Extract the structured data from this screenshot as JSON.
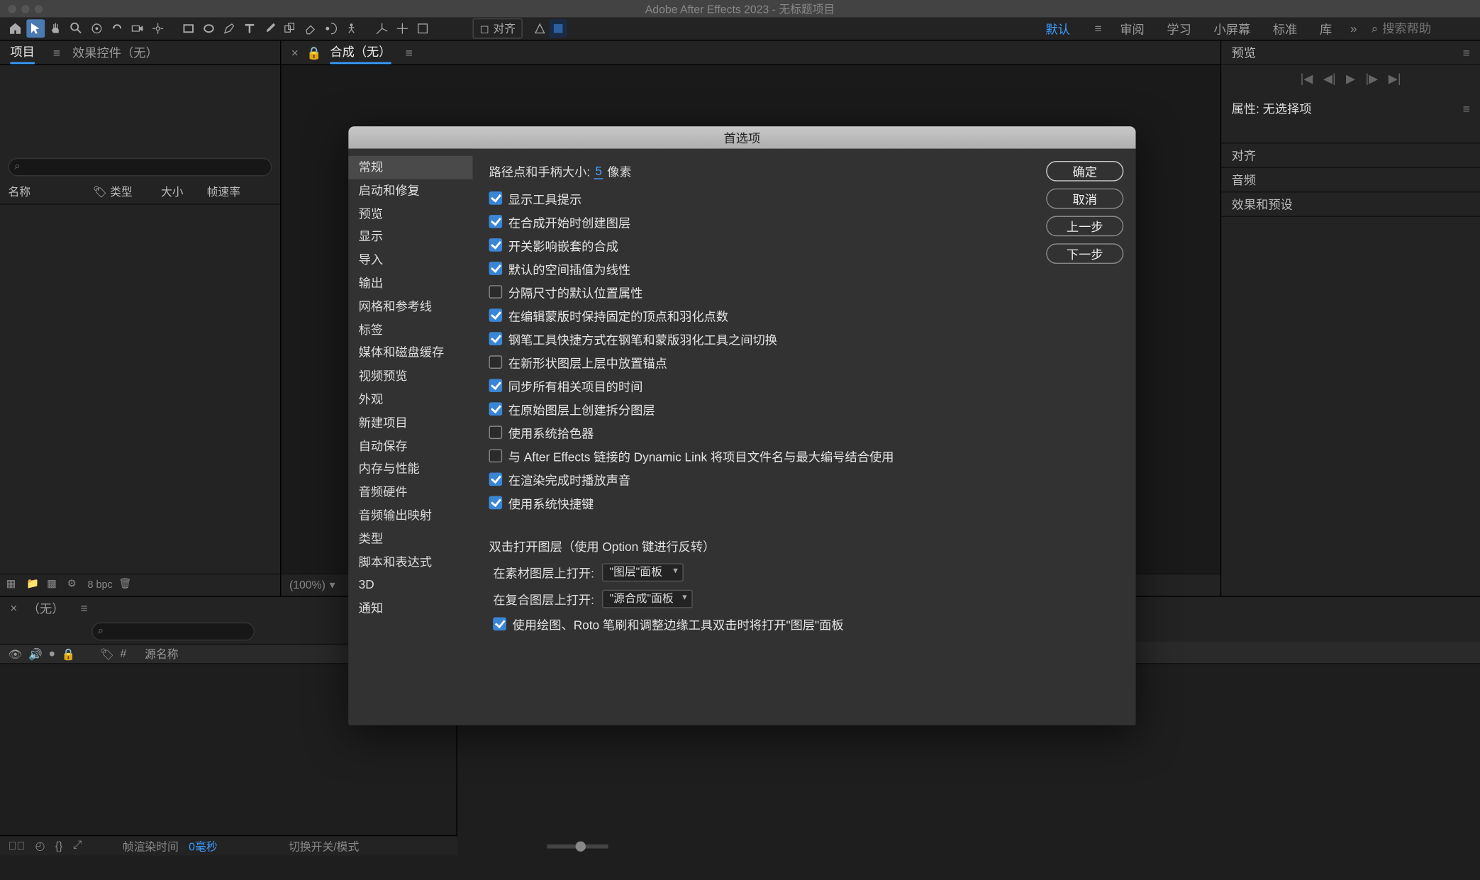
{
  "title_bar": {
    "title": "Adobe After Effects 2023 - 无标题项目"
  },
  "toolbar": {
    "align_label": "对齐",
    "workspaces": [
      "默认",
      "审阅",
      "学习",
      "小屏幕",
      "标准",
      "库"
    ],
    "active_workspace": "默认",
    "search_placeholder": "搜索帮助"
  },
  "left_panel": {
    "tabs": {
      "project": "项目",
      "effect_controls": "效果控件（无）"
    },
    "columns": {
      "name": "名称",
      "tag": "",
      "type": "类型",
      "size": "大小",
      "fps": "帧速率"
    },
    "footer_bpc": "8 bpc"
  },
  "comp_panel": {
    "tab_label": "合成（无）",
    "zoom": "(100%)"
  },
  "right_panel": {
    "preview": "预览",
    "attrs_title": "属性: 无选择项",
    "rows": [
      "对齐",
      "音频",
      "效果和预设"
    ]
  },
  "timeline": {
    "tab": "（无）",
    "col_source": "源名称",
    "status_frame_render": "帧渲染时间",
    "status_time_val": "0毫秒",
    "toggle_label": "切换开关/模式"
  },
  "dialog": {
    "title": "首选项",
    "side": [
      "常规",
      "启动和修复",
      "预览",
      "显示",
      "导入",
      "输出",
      "网格和参考线",
      "标签",
      "媒体和磁盘缓存",
      "视频预览",
      "外观",
      "新建项目",
      "自动保存",
      "内存与性能",
      "音频硬件",
      "音频输出映射",
      "类型",
      "脚本和表达式",
      "3D",
      "通知"
    ],
    "active_side": "常规",
    "buttons": {
      "ok": "确定",
      "cancel": "取消",
      "prev": "上一步",
      "next": "下一步"
    },
    "path_size_label": "路径点和手柄大小:",
    "path_size_value": "5",
    "path_size_unit": "像素",
    "checks": [
      {
        "label": "显示工具提示",
        "checked": true
      },
      {
        "label": "在合成开始时创建图层",
        "checked": true
      },
      {
        "label": "开关影响嵌套的合成",
        "checked": true
      },
      {
        "label": "默认的空间插值为线性",
        "checked": true
      },
      {
        "label": "分隔尺寸的默认位置属性",
        "checked": false
      },
      {
        "label": "在编辑蒙版时保持固定的顶点和羽化点数",
        "checked": true
      },
      {
        "label": "钢笔工具快捷方式在钢笔和蒙版羽化工具之间切换",
        "checked": true
      },
      {
        "label": "在新形状图层上层中放置锚点",
        "checked": false
      },
      {
        "label": "同步所有相关项目的时间",
        "checked": true
      },
      {
        "label": "在原始图层上创建拆分图层",
        "checked": true
      },
      {
        "label": "使用系统拾色器",
        "checked": false
      },
      {
        "label": "与 After Effects 链接的 Dynamic Link 将项目文件名与最大编号结合使用",
        "checked": false
      },
      {
        "label": "在渲染完成时播放声音",
        "checked": true
      },
      {
        "label": "使用系统快捷键",
        "checked": true
      }
    ],
    "dbl_open_title": "双击打开图层（使用 Option 键进行反转）",
    "open_footage_label": "在素材图层上打开:",
    "open_footage_value": "\"图层\"面板",
    "open_comp_label": "在复合图层上打开:",
    "open_comp_value": "\"源合成\"面板",
    "paint_check": {
      "label": "使用绘图、Roto 笔刷和调整边缘工具双击时将打开\"图层\"面板",
      "checked": true
    }
  }
}
